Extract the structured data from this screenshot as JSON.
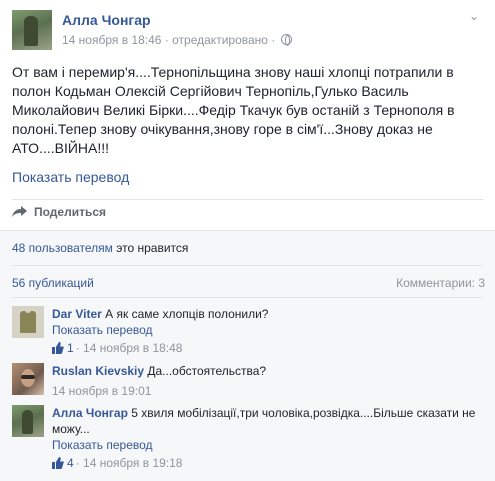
{
  "post": {
    "author": "Алла Чонгар",
    "date": "14 ноября в 18:46",
    "edited": "· отредактировано ·",
    "text": "От вам і перемир'я....Тернопільщина знову наші хлопці потрапили в полон Кодьман Олексій Сергійович Тернопіль,Гулько Василь Миколайович Великі Бірки....Федір Ткачук був останій з Тернополя в полоні.Тепер знову очікування,знову горе в сім'ї...Знову доказ не АТО....ВІЙНА!!!",
    "translate": "Показать перевод",
    "share": "Поделиться",
    "icons": {
      "options": "chevron-down-icon",
      "privacy": "globe-icon",
      "share": "share-arrow-icon"
    }
  },
  "ufi": {
    "likes_link": "48 пользователям",
    "likes_text": " это нравится",
    "publications": "56 публикаций",
    "comment_count": "Комментарии: 3"
  },
  "comments": [
    {
      "author": "Dar Viter",
      "text": " А як саме хлопців полонили?",
      "translate": "Показать перевод",
      "likes": "1",
      "time": " · 14 ноября в 18:48"
    },
    {
      "author": "Ruslan Kievskiy",
      "text": " Да...обстоятельства?",
      "time": "14 ноября в 19:01"
    },
    {
      "author": "Алла Чонгар",
      "text": " 5 хвиля мобілізації,три чоловіка,розвідка....Більше сказати не можу...",
      "translate": "Показать перевод",
      "likes": "4",
      "time": " · 14 ноября в 19:18"
    }
  ],
  "colors": {
    "link": "#365899",
    "meta": "#90949c",
    "text": "#1d2129",
    "ufi_bg": "#f6f7f9"
  }
}
